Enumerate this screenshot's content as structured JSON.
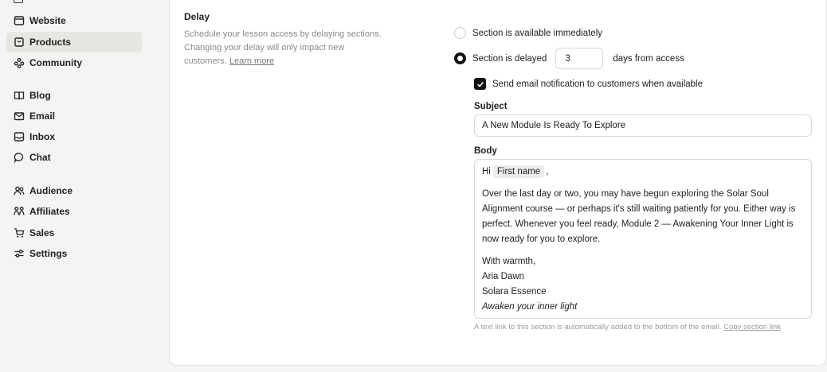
{
  "sidebar": {
    "items": [
      {
        "label": "Website",
        "icon": "browser-icon"
      },
      {
        "label": "Products",
        "icon": "package-icon"
      },
      {
        "label": "Community",
        "icon": "community-icon"
      },
      {
        "label": "Blog",
        "icon": "book-icon"
      },
      {
        "label": "Email",
        "icon": "mail-icon"
      },
      {
        "label": "Inbox",
        "icon": "inbox-icon"
      },
      {
        "label": "Chat",
        "icon": "chat-bubble-icon"
      },
      {
        "label": "Audience",
        "icon": "users-icon"
      },
      {
        "label": "Affiliates",
        "icon": "affiliates-icon"
      },
      {
        "label": "Sales",
        "icon": "cart-icon"
      },
      {
        "label": "Settings",
        "icon": "sliders-icon"
      }
    ],
    "active": "Products"
  },
  "delay": {
    "title": "Delay",
    "description": "Schedule your lesson access by delaying sections. Changing your delay will only impact new customers.",
    "learn_more": "Learn more",
    "option_immediate": "Section is available immediately",
    "option_delayed": "Section is delayed",
    "days_value": "3",
    "days_suffix": "days from access",
    "selected": "delayed"
  },
  "notification": {
    "checkbox_label": "Send email notification to customers when available",
    "checked": true,
    "subject_label": "Subject",
    "subject_value": "A New Module Is Ready To Explore",
    "body_label": "Body",
    "body": {
      "greeting": "Hi",
      "merge_tag": "First name",
      "greeting_end": ",",
      "paragraph": "Over the last day or two, you may have begun exploring the Solar Soul Alignment course — or perhaps it's still waiting patiently for you. Either way is perfect. Whenever you feel ready, Module 2 — Awakening Your Inner Light  is now ready for you to explore.",
      "signoff": "With warmth,",
      "name": "Aria Dawn",
      "brand": "Solara Essence",
      "tagline": "Awaken your inner light"
    },
    "footnote": "A text link to this section is automatically added to the bottom of the email.",
    "copy_link": "Copy section link"
  }
}
